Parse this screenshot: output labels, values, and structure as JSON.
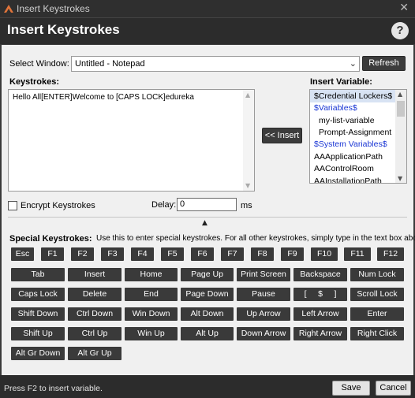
{
  "window": {
    "title": "Insert Keystrokes"
  },
  "header": {
    "title": "Insert Keystrokes",
    "help_symbol": "?"
  },
  "select_window": {
    "label": "Select Window:",
    "value": "Untitled - Notepad",
    "refresh_label": "Refresh"
  },
  "keystrokes": {
    "label": "Keystrokes:",
    "value": "Hello All[ENTER]Welcome to [CAPS LOCK]edureka"
  },
  "insert_button": {
    "label": "<< Insert"
  },
  "insert_variable": {
    "label": "Insert Variable:",
    "items": [
      {
        "text": "$Credential Lockers$",
        "kind": "selected"
      },
      {
        "text": "$Variables$",
        "kind": "header"
      },
      {
        "text": "my-list-variable",
        "kind": "child"
      },
      {
        "text": "Prompt-Assignment",
        "kind": "child"
      },
      {
        "text": "$System Variables$",
        "kind": "header"
      },
      {
        "text": "AAApplicationPath",
        "kind": "child"
      },
      {
        "text": "AAControlRoom",
        "kind": "child"
      },
      {
        "text": "AAInstallationPath",
        "kind": "child"
      }
    ]
  },
  "encrypt": {
    "label": "Encrypt Keystrokes",
    "checked": false
  },
  "delay": {
    "label": "Delay:",
    "value": "0",
    "unit": "ms"
  },
  "special": {
    "label": "Special Keystrokes:",
    "hint": "Use this to enter special keystrokes. For all other keystrokes, simply type in the text box above.",
    "fkeys": [
      "Esc",
      "F1",
      "F2",
      "F3",
      "F4",
      "F5",
      "F6",
      "F7",
      "F8",
      "F9",
      "F10",
      "F11",
      "F12"
    ],
    "rows": [
      [
        "Tab",
        "Insert",
        "Home",
        "Page Up",
        "Print Screen",
        "Backspace",
        "Num Lock"
      ],
      [
        "Caps Lock",
        "Delete",
        "End",
        "Page Down",
        "Pause",
        "[     $     ]",
        "Scroll Lock"
      ],
      [
        "Shift Down",
        "Ctrl Down",
        "Win Down",
        "Alt Down",
        "Up Arrow",
        "Left Arrow",
        "Enter"
      ],
      [
        "Shift Up",
        "Ctrl Up",
        "Win Up",
        "Alt Up",
        "Down Arrow",
        "Right Arrow",
        "Right Click"
      ],
      [
        "Alt Gr Down",
        "Alt Gr Up"
      ]
    ]
  },
  "status": {
    "text": "Press F2 to insert variable."
  },
  "footer": {
    "save_label": "Save",
    "cancel_label": "Cancel"
  },
  "colors": {
    "accent_blue": "#1a36d4",
    "dark_button": "#3a3a3a",
    "selection": "#d8e3f3"
  }
}
